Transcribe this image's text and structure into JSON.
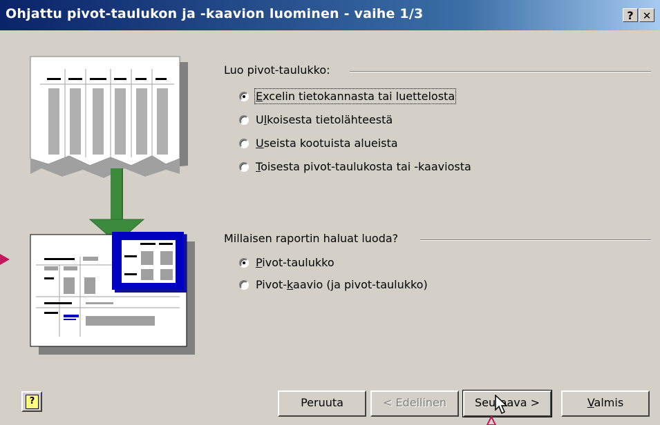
{
  "window": {
    "title": "Ohjattu pivot-taulukon ja -kaavion luominen - vaihe 1/3",
    "help_btn": "?",
    "close_btn": "✕"
  },
  "source_group": {
    "label": "Luo pivot-taulukko:",
    "options": [
      {
        "pre": "",
        "acc": "E",
        "post": "xcelin tietokannasta tai luettelosta",
        "checked": true
      },
      {
        "pre": "U",
        "acc": "l",
        "post": "koisesta tietolähteestä",
        "checked": false
      },
      {
        "pre": "",
        "acc": "U",
        "post": "seista kootuista alueista",
        "checked": false
      },
      {
        "pre": "",
        "acc": "T",
        "post": "oisesta pivot-taulukosta tai -kaaviosta",
        "checked": false
      }
    ]
  },
  "report_group": {
    "label": "Millaisen raportin haluat luoda?",
    "options": [
      {
        "pre": "",
        "acc": "P",
        "post": "ivot-taulukko",
        "checked": true
      },
      {
        "pre": "Pivot-",
        "acc": "k",
        "post": "aavio (ja pivot-taulukko)",
        "checked": false
      }
    ]
  },
  "buttons": {
    "cancel": "Peruuta",
    "back": "< Edellinen",
    "next": "Seuraava >",
    "finish_acc": "V",
    "finish_rest": "almis"
  },
  "colors": {
    "title_start": "#0a246a",
    "title_end": "#a6caf0",
    "arrow_green": "#3c8a3c",
    "accent_blue": "#0000c0",
    "pointer_pink": "#c0185a"
  }
}
